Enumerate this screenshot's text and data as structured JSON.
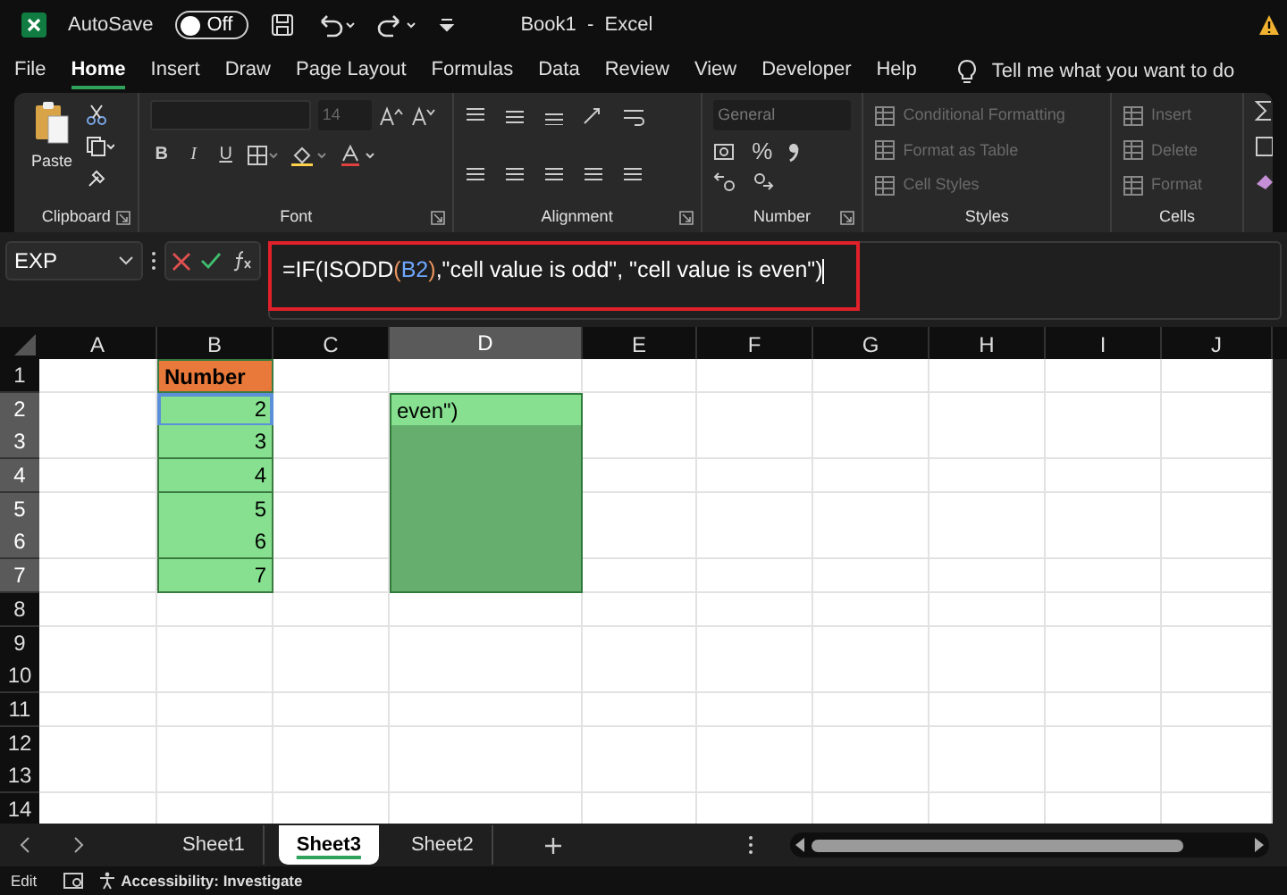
{
  "title_bar": {
    "autosave_label": "AutoSave",
    "autosave": {
      "on": false,
      "label": "Off"
    },
    "title": "Book1  -  Excel"
  },
  "menu_tabs": [
    {
      "label": "File",
      "selected": false
    },
    {
      "label": "Home",
      "selected": true
    },
    {
      "label": "Insert",
      "selected": false
    },
    {
      "label": "Draw",
      "selected": false
    },
    {
      "label": "Page Layout",
      "selected": false
    },
    {
      "label": "Formulas",
      "selected": false
    },
    {
      "label": "Data",
      "selected": false
    },
    {
      "label": "Review",
      "selected": false
    },
    {
      "label": "View",
      "selected": false
    },
    {
      "label": "Developer",
      "selected": false
    },
    {
      "label": "Help",
      "selected": false
    }
  ],
  "tell_me": {
    "placeholder": "Tell me what you want to do"
  },
  "ribbon": {
    "clipboard": {
      "paste": "Paste",
      "label": "Clipboard"
    },
    "font": {
      "size": "14",
      "bold": "B",
      "italic": "I",
      "underline": "U",
      "label": "Font"
    },
    "alignment": {
      "label": "Alignment"
    },
    "number": {
      "format": "General",
      "percent": "%",
      "label": "Number"
    },
    "styles": {
      "items": [
        {
          "label": "Conditional Formatting",
          "disabled": true
        },
        {
          "label": "Format as Table",
          "disabled": true
        },
        {
          "label": "Cell Styles",
          "disabled": true
        }
      ],
      "label": "Styles"
    },
    "cells": {
      "items": [
        {
          "label": "Insert",
          "disabled": true
        },
        {
          "label": "Delete",
          "disabled": true
        },
        {
          "label": "Format",
          "disabled": true
        }
      ],
      "label": "Cells"
    }
  },
  "formula_bar": {
    "name_box": "EXP",
    "formula": [
      {
        "text": "=IF(ISODD",
        "kind": "plain"
      },
      {
        "text": "(",
        "kind": "paren"
      },
      {
        "text": "B2",
        "kind": "reference"
      },
      {
        "text": ")",
        "kind": "paren"
      },
      {
        "text": ",\"cell value is odd\", \"cell value is even\")",
        "kind": "plain"
      }
    ]
  },
  "sheet": {
    "columns": [
      {
        "label": "A",
        "selected": false
      },
      {
        "label": "B",
        "selected": false
      },
      {
        "label": "C",
        "selected": false
      },
      {
        "label": "D",
        "selected": true
      },
      {
        "label": "E",
        "selected": false
      },
      {
        "label": "F",
        "selected": false
      },
      {
        "label": "G",
        "selected": false
      },
      {
        "label": "H",
        "selected": false
      },
      {
        "label": "I",
        "selected": false
      },
      {
        "label": "J",
        "selected": false
      }
    ],
    "rows": [
      {
        "label": "1",
        "selected": false,
        "cells": [
          {
            "kind": "blank"
          },
          {
            "text": "Number",
            "kind": "header"
          }
        ]
      },
      {
        "label": "2",
        "selected": true,
        "cells": [
          {
            "kind": "blank"
          },
          {
            "text": "2",
            "kind": "value",
            "referenced": true
          },
          {
            "kind": "blank"
          },
          {
            "text": "even\")",
            "kind": "editing"
          }
        ]
      },
      {
        "label": "3",
        "selected": true,
        "cells": [
          {
            "kind": "blank"
          },
          {
            "text": "3",
            "kind": "value",
            "referenced": false
          }
        ]
      },
      {
        "label": "4",
        "selected": true,
        "cells": [
          {
            "kind": "blank"
          },
          {
            "text": "4",
            "kind": "value",
            "referenced": false
          }
        ]
      },
      {
        "label": "5",
        "selected": true,
        "cells": [
          {
            "kind": "blank"
          },
          {
            "text": "5",
            "kind": "value",
            "referenced": false
          }
        ]
      },
      {
        "label": "6",
        "selected": true,
        "cells": [
          {
            "kind": "blank"
          },
          {
            "text": "6",
            "kind": "value",
            "referenced": false
          }
        ]
      },
      {
        "label": "7",
        "selected": true,
        "cells": [
          {
            "kind": "blank"
          },
          {
            "text": "7",
            "kind": "value",
            "referenced": false
          }
        ]
      },
      {
        "label": "8",
        "selected": false
      },
      {
        "label": "9",
        "selected": false
      },
      {
        "label": "10",
        "selected": false
      },
      {
        "label": "11",
        "selected": false
      },
      {
        "label": "12",
        "selected": false
      },
      {
        "label": "13",
        "selected": false
      },
      {
        "label": "14",
        "selected": false
      }
    ]
  },
  "sheet_tabs": [
    {
      "label": "Sheet1",
      "selected": false
    },
    {
      "label": "Sheet3",
      "selected": true
    },
    {
      "label": "Sheet2",
      "selected": false
    }
  ],
  "status_bar": {
    "mode": "Edit",
    "accessibility": "Accessibility: Investigate"
  }
}
